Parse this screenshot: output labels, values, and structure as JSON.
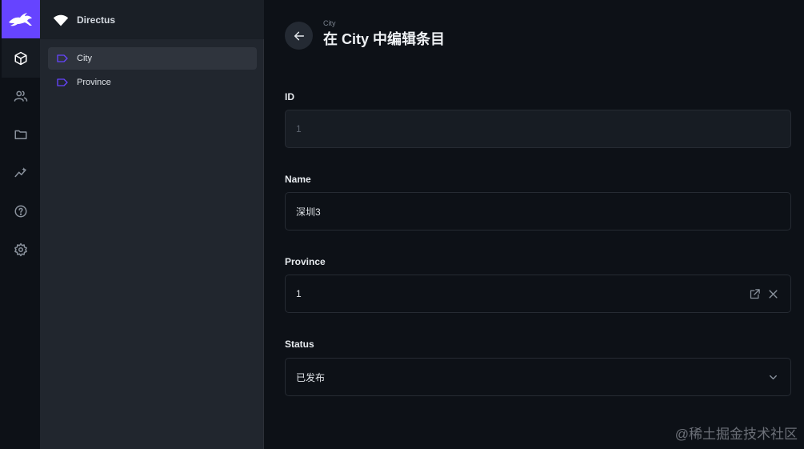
{
  "project": {
    "name": "Directus"
  },
  "nav": {
    "items": [
      {
        "label": "City"
      },
      {
        "label": "Province"
      }
    ]
  },
  "header": {
    "breadcrumb": "City",
    "title": "在 City 中编辑条目"
  },
  "form": {
    "id": {
      "label": "ID",
      "value": "1"
    },
    "name": {
      "label": "Name",
      "value": "深圳3"
    },
    "province": {
      "label": "Province",
      "value": "1"
    },
    "status": {
      "label": "Status",
      "value": "已发布"
    }
  },
  "watermark": "@稀土掘金技术社区",
  "colors": {
    "accent": "#6644ff",
    "background": "#0d1117",
    "nav_background": "#21262e"
  },
  "icons": {
    "rail": [
      "box-icon",
      "users-icon",
      "folder-icon",
      "insights-icon",
      "help-icon",
      "settings-icon"
    ]
  }
}
